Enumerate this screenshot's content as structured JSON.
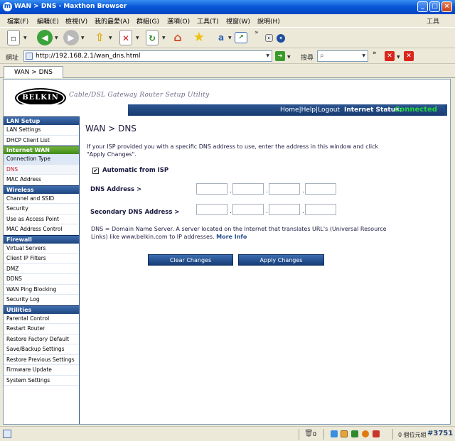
{
  "window": {
    "title": "WAN > DNS - Maxthon Browser",
    "minimize": "_",
    "maximize": "□",
    "close": "×"
  },
  "menu": {
    "items": [
      "檔案(F)",
      "編輯(E)",
      "檢視(V)",
      "我的最愛(A)",
      "群組(G)",
      "選項(O)",
      "工具(T)",
      "視窗(W)",
      "說明(H)"
    ],
    "right_label": "工具"
  },
  "toolbar": {
    "icons": [
      "new-page-icon",
      "back-icon",
      "forward-icon",
      "up-icon",
      "stop-icon",
      "refresh-icon",
      "home-icon",
      "favorites-star-icon",
      "translate-icon",
      "screen-icon",
      "overflow-chevron-icon",
      "rss-icon",
      "compass-icon"
    ],
    "overflow": "»"
  },
  "address": {
    "label": "網址",
    "url": "http://192.168.2.1/wan_dns.html",
    "go": "➔",
    "search_label": "搜尋",
    "search_value": "",
    "overflow": "»"
  },
  "tabs": [
    {
      "label": "WAN > DNS"
    }
  ],
  "header": {
    "logo": "BELKIN",
    "tagline": "Cable/DSL Gateway Router Setup Utility",
    "links": [
      "Home",
      "Help",
      "Logout"
    ],
    "status_label": "Internet Status:",
    "status_value": "Connected",
    "colors": {
      "nav_bar": "#1f467f",
      "status_connected": "#22d63a"
    }
  },
  "sidebar": {
    "sections": [
      {
        "title": "LAN Setup",
        "items": [
          "LAN Settings",
          "DHCP Client List"
        ]
      },
      {
        "title": "Internet WAN",
        "items": [
          "Connection Type",
          "DNS",
          "MAC Address"
        ]
      },
      {
        "title": "Wireless",
        "items": [
          "Channel and SSID",
          "Security",
          "Use as Access Point",
          "MAC Address Control"
        ]
      },
      {
        "title": "Firewall",
        "items": [
          "Virtual Servers",
          "Client IP Filters",
          "DMZ",
          "DDNS",
          "WAN Ping Blocking",
          "Security Log"
        ]
      },
      {
        "title": "Utilities",
        "items": [
          "Parental Control",
          "Restart Router",
          "Restore Factory Default",
          "Save/Backup Settings",
          "Restore Previous Settings",
          "Firmware Update",
          "System Settings"
        ]
      }
    ],
    "active_item": "DNS"
  },
  "main": {
    "title": "WAN > DNS",
    "intro": "If your ISP provided you with a specific DNS address to use, enter the address in this window and click \"Apply Changes\".",
    "auto_isp": {
      "label": "Automatic from ISP",
      "checked": true,
      "mark": "✔"
    },
    "dns_label": "DNS Address >",
    "secondary_label": "Secondary DNS Address >",
    "dns_values": [
      "",
      "",
      "",
      ""
    ],
    "secondary_values": [
      "",
      "",
      "",
      ""
    ],
    "dot": ".",
    "note": "DNS = Domain Name Server. A server located on the Internet that translates URL's (Universal Resource Links) like www.belkin.com to IP addresses.",
    "more_info": "More Info",
    "clear_button": "Clear Changes",
    "apply_button": "Apply Changes"
  },
  "statusbar": {
    "count": "0",
    "text": "0 個位元組",
    "watermark": "#3751"
  }
}
